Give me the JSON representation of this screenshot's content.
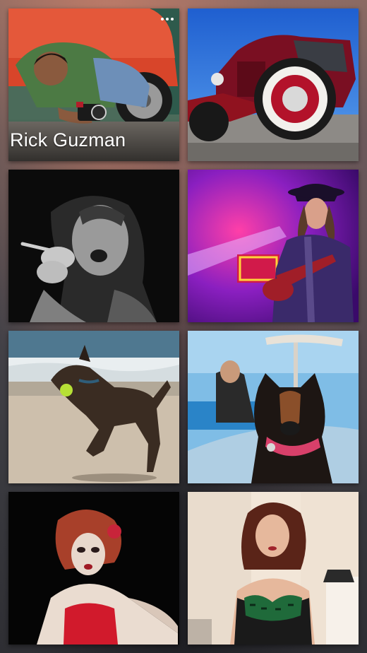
{
  "gallery": {
    "featured_caption": "Rick Guzman",
    "overflow_icon": "more-horizontal-icon",
    "accent_color": "#ffffff",
    "photos": [
      {
        "subject": "photographer-crouching-by-red-car"
      },
      {
        "subject": "red-hot-rod-whitewall-tire"
      },
      {
        "subject": "singer-black-and-white-microphone"
      },
      {
        "subject": "guitarist-purple-stage-light"
      },
      {
        "subject": "dog-running-beach-tennis-ball"
      },
      {
        "subject": "doberman-portrait-pink-collar"
      },
      {
        "subject": "burlesque-performer-red-corset"
      },
      {
        "subject": "woman-green-corset-studio"
      }
    ]
  }
}
